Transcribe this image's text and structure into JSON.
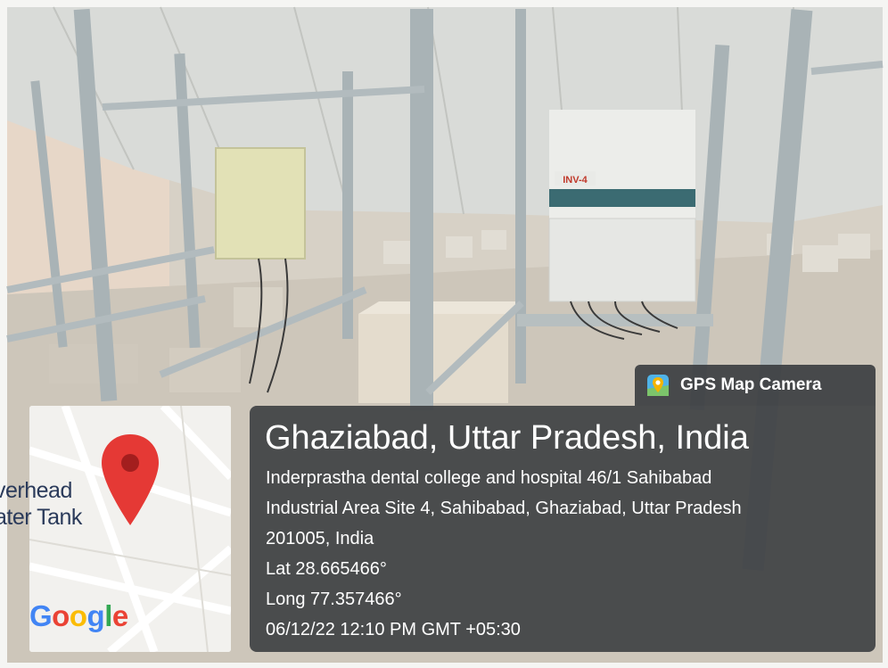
{
  "badge": {
    "label": "GPS Map Camera",
    "icon": "map-pin-icon"
  },
  "location": {
    "title": "Ghaziabad, Uttar Pradesh, India",
    "address_line1": "Inderprastha dental college and hospital 46/1 Sahibabad",
    "address_line2": "Industrial Area Site 4, Sahibabad, Ghaziabad, Uttar Pradesh",
    "address_line3": "201005, India",
    "lat": "Lat 28.665466°",
    "long": "Long 77.357466°",
    "datetime": "06/12/22 12:10 PM GMT +05:30"
  },
  "map": {
    "label_line1": "verhead",
    "label_line2": "ater Tank",
    "logo_text": "Google",
    "pin_color": "#e53935"
  },
  "scene": {
    "inverter_label": "INV-4"
  },
  "colors": {
    "overlay": "#3c3e41",
    "steel": "#a9b3b6",
    "panel": "#d9dad5"
  }
}
